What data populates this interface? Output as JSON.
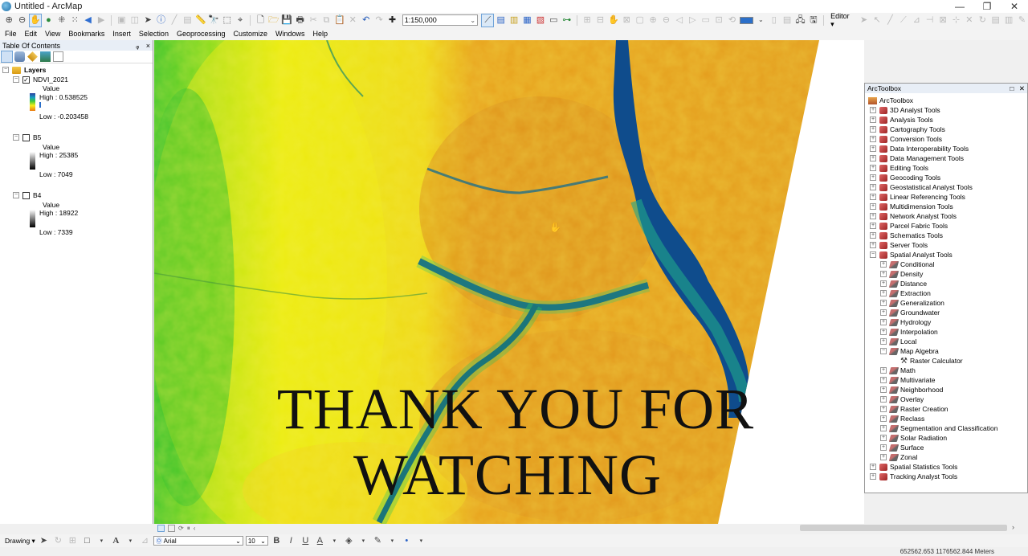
{
  "window": {
    "title": "Untitled - ArcMap",
    "controls": {
      "minimize": "—",
      "restore": "❐",
      "close": "✕"
    }
  },
  "toolbar": {
    "scale_value": "1:150,000",
    "editor_label": "Editor",
    "accent_color": "#2b6fc9"
  },
  "menubar": {
    "items": [
      "File",
      "Edit",
      "View",
      "Bookmarks",
      "Insert",
      "Selection",
      "Geoprocessing",
      "Customize",
      "Windows",
      "Help"
    ]
  },
  "toc": {
    "title": "Table Of Contents",
    "pin_label": "ᵩ",
    "close_label": "×",
    "root_label": "Layers",
    "layers": [
      {
        "name": "NDVI_2021",
        "checked": true,
        "check_glyph": "✓",
        "value_label": "Value",
        "high": "High : 0.538525",
        "low": "Low : -0.203458"
      },
      {
        "name": "B5",
        "checked": false,
        "check_glyph": "",
        "value_label": "Value",
        "high": "High : 25385",
        "low": "Low : 7049"
      },
      {
        "name": "B4",
        "checked": false,
        "check_glyph": "",
        "value_label": "Value",
        "high": "High : 18922",
        "low": "Low : 7339"
      }
    ]
  },
  "map": {
    "overlay_line1": "THANK YOU FOR",
    "overlay_line2": "WATCHING",
    "colors": {
      "orange": "#e59a1c",
      "yellow": "#f2ec10",
      "green": "#36c92f",
      "water": "#0f4c8c"
    }
  },
  "arctoolbox": {
    "title": "ArcToolbox",
    "root": "ArcToolbox",
    "toolboxes_top": [
      "3D Analyst Tools",
      "Analysis Tools",
      "Cartography Tools",
      "Conversion Tools",
      "Data Interoperability Tools",
      "Data Management Tools",
      "Editing Tools",
      "Geocoding Tools",
      "Geostatistical Analyst Tools",
      "Linear Referencing Tools",
      "Multidimension Tools",
      "Network Analyst Tools",
      "Parcel Fabric Tools",
      "Schematics Tools",
      "Server Tools",
      "Spatial Analyst Tools"
    ],
    "spatial_analyst_toolsets_a": [
      "Conditional",
      "Density",
      "Distance",
      "Extraction",
      "Generalization",
      "Groundwater",
      "Hydrology",
      "Interpolation",
      "Local",
      "Map Algebra"
    ],
    "map_algebra_tool": "Raster Calculator",
    "spatial_analyst_toolsets_b": [
      "Math",
      "Multivariate",
      "Neighborhood",
      "Overlay",
      "Raster Creation",
      "Reclass",
      "Segmentation and Classification",
      "Solar Radiation",
      "Surface",
      "Zonal"
    ],
    "toolboxes_bottom": [
      "Spatial Statistics Tools",
      "Tracking Analyst Tools"
    ]
  },
  "drawing_toolbar": {
    "drawing_label": "Drawing",
    "font_name": "Arial",
    "font_size": "10",
    "bold": "B",
    "italic": "I",
    "underline": "U",
    "font_color_glyph": "A"
  },
  "status": {
    "coordinates": "652562.653  1176562.844 Meters"
  }
}
